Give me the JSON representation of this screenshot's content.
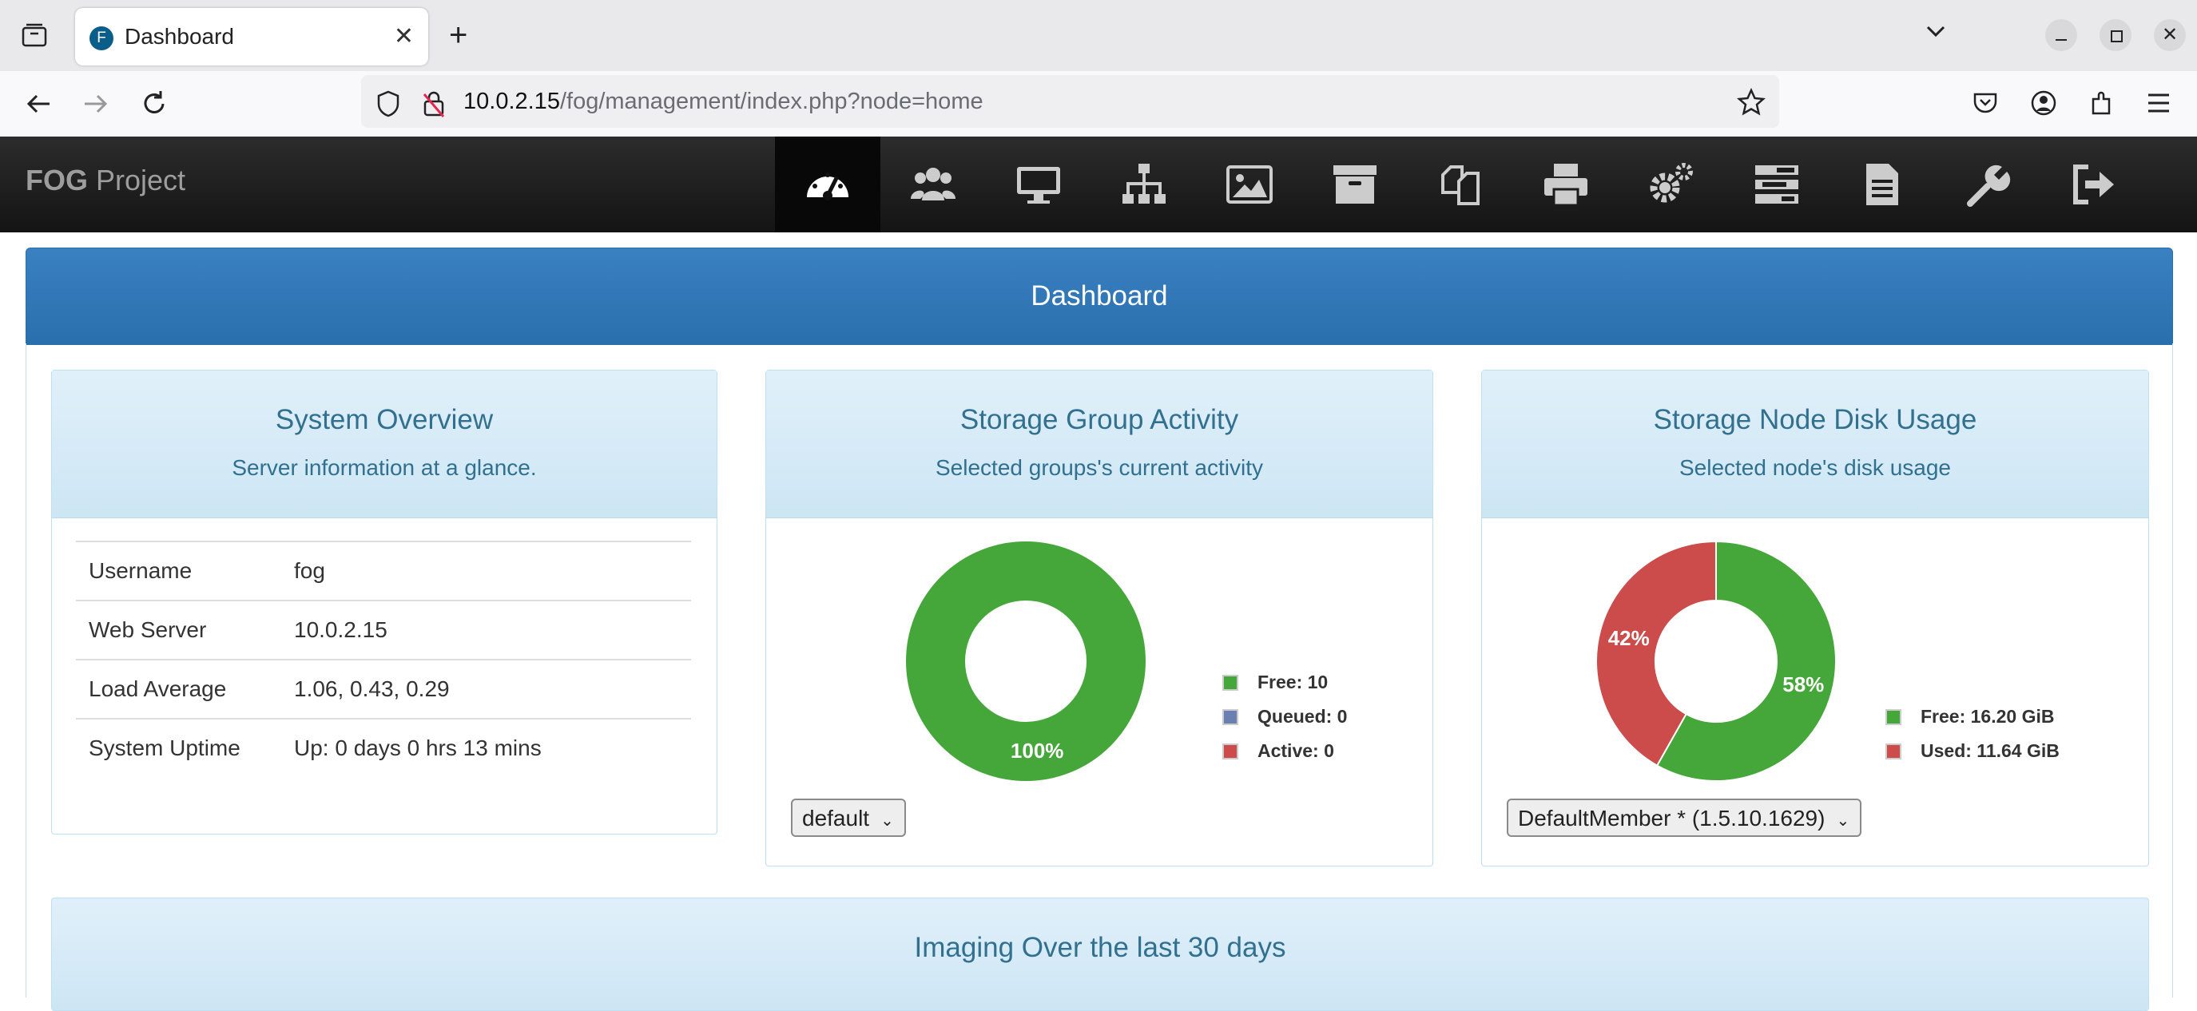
{
  "browser": {
    "tab_title": "Dashboard",
    "tab_favicon": "F",
    "url_host": "10.0.2.15",
    "url_path": "/fog/management/index.php?node=home"
  },
  "app": {
    "brand_bold": "FOG",
    "brand_rest": " Project",
    "menu": [
      {
        "name": "dashboard-icon",
        "active": true
      },
      {
        "name": "users-icon"
      },
      {
        "name": "hosts-icon"
      },
      {
        "name": "groups-icon"
      },
      {
        "name": "images-icon"
      },
      {
        "name": "storage-icon"
      },
      {
        "name": "snapins-icon"
      },
      {
        "name": "printers-icon"
      },
      {
        "name": "service-config-icon"
      },
      {
        "name": "tasks-icon"
      },
      {
        "name": "reports-icon"
      },
      {
        "name": "fog-config-icon"
      },
      {
        "name": "logout-icon"
      }
    ]
  },
  "dashboard": {
    "title": "Dashboard",
    "system_overview": {
      "title": "System Overview",
      "subtitle": "Server information at a glance.",
      "rows": [
        {
          "label": "Username",
          "value": "fog"
        },
        {
          "label": "Web Server",
          "value": "10.0.2.15"
        },
        {
          "label": "Load Average",
          "value": "1.06, 0.43, 0.29"
        },
        {
          "label": "System Uptime",
          "value": "Up: 0 days 0 hrs 13 mins"
        }
      ]
    },
    "storage_group": {
      "title": "Storage Group Activity",
      "subtitle": "Selected groups's current activity",
      "legend": [
        {
          "label": "Free: 10",
          "color": "#45a73a"
        },
        {
          "label": "Queued: 0",
          "color": "#6a80b0"
        },
        {
          "label": "Active: 0",
          "color": "#cc4b4b"
        }
      ],
      "select_value": "default"
    },
    "storage_node": {
      "title": "Storage Node Disk Usage",
      "subtitle": "Selected node's disk usage",
      "legend": [
        {
          "label": "Free: 16.20 GiB",
          "color": "#45a73a"
        },
        {
          "label": "Used: 11.64 GiB",
          "color": "#cc4b4b"
        }
      ],
      "select_value": "DefaultMember * (1.5.10.1629)"
    },
    "imaging_title": "Imaging Over the last 30 days"
  },
  "chart_data": [
    {
      "type": "pie",
      "categories": [
        "Free",
        "Queued",
        "Active"
      ],
      "values": [
        10,
        0,
        0
      ],
      "labels": [
        "100%"
      ],
      "colors": [
        "#45a73a",
        "#6a80b0",
        "#cc4b4b"
      ]
    },
    {
      "type": "pie",
      "categories": [
        "Free",
        "Used"
      ],
      "values": [
        16.2,
        11.64
      ],
      "labels": [
        "58%",
        "42%"
      ],
      "colors": [
        "#45a73a",
        "#cc4b4b"
      ]
    }
  ]
}
